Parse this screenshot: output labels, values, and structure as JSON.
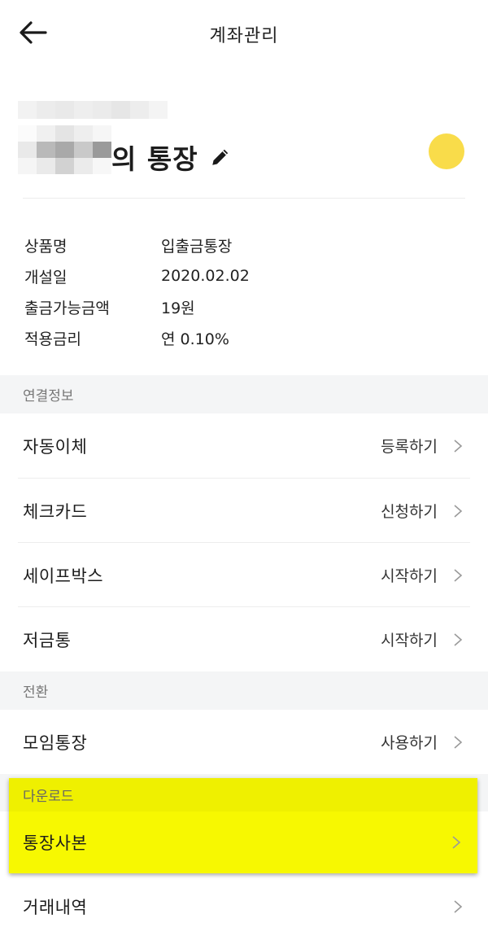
{
  "header": {
    "title": "계좌관리",
    "back_icon": "arrow-left-icon"
  },
  "account": {
    "title_suffix": "의 통장",
    "edit_icon": "pencil-icon",
    "coin_color": "#f9dc4a"
  },
  "info": [
    {
      "label": "상품명",
      "value": "입출금통장"
    },
    {
      "label": "개설일",
      "value": "2020.02.02"
    },
    {
      "label": "출금가능금액",
      "value": "19원"
    },
    {
      "label": "적용금리",
      "value": "연 0.10%"
    }
  ],
  "sections": {
    "connected": {
      "title": "연결정보",
      "items": [
        {
          "label": "자동이체",
          "action": "등록하기"
        },
        {
          "label": "체크카드",
          "action": "신청하기"
        },
        {
          "label": "세이프박스",
          "action": "시작하기"
        },
        {
          "label": "저금통",
          "action": "시작하기"
        }
      ]
    },
    "convert": {
      "title": "전환",
      "items": [
        {
          "label": "모임통장",
          "action": "사용하기"
        }
      ]
    },
    "download": {
      "title": "다운로드",
      "items": [
        {
          "label": "통장사본",
          "action": ""
        },
        {
          "label": "거래내역",
          "action": ""
        }
      ]
    }
  },
  "colors": {
    "highlight": "#f7f801",
    "section_bg": "#f4f5f6"
  }
}
